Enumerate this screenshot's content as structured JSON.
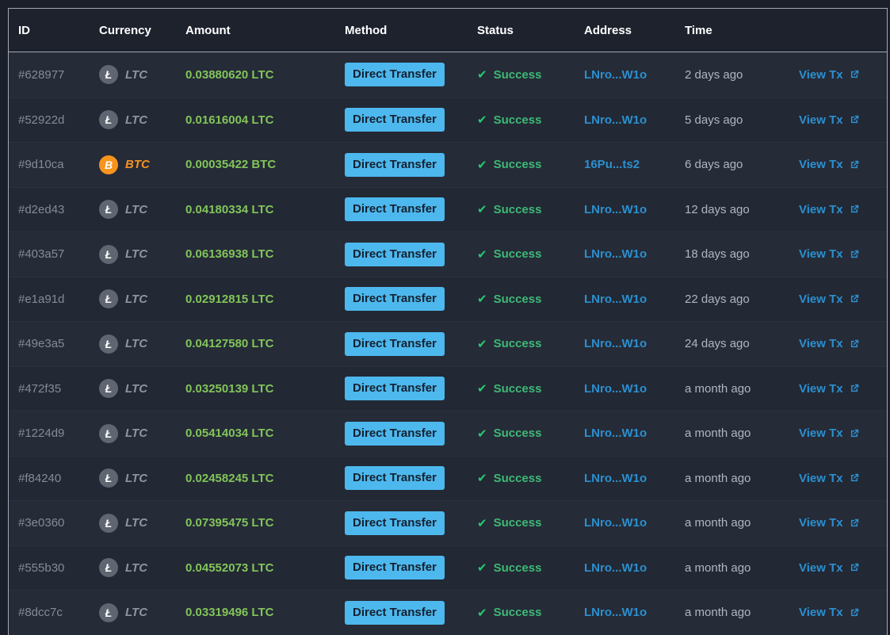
{
  "table": {
    "headers": {
      "id": "ID",
      "currency": "Currency",
      "amount": "Amount",
      "method": "Method",
      "status": "Status",
      "address": "Address",
      "time": "Time",
      "actions": ""
    },
    "rows": [
      {
        "id": "#628977",
        "currency": "LTC",
        "amount": "0.03880620 LTC",
        "method": "Direct Transfer",
        "status": "Success",
        "address": "LNro...W1o",
        "time": "2 days ago",
        "link": "View Tx"
      },
      {
        "id": "#52922d",
        "currency": "LTC",
        "amount": "0.01616004 LTC",
        "method": "Direct Transfer",
        "status": "Success",
        "address": "LNro...W1o",
        "time": "5 days ago",
        "link": "View Tx"
      },
      {
        "id": "#9d10ca",
        "currency": "BTC",
        "amount": "0.00035422 BTC",
        "method": "Direct Transfer",
        "status": "Success",
        "address": "16Pu...ts2",
        "time": "6 days ago",
        "link": "View Tx"
      },
      {
        "id": "#d2ed43",
        "currency": "LTC",
        "amount": "0.04180334 LTC",
        "method": "Direct Transfer",
        "status": "Success",
        "address": "LNro...W1o",
        "time": "12 days ago",
        "link": "View Tx"
      },
      {
        "id": "#403a57",
        "currency": "LTC",
        "amount": "0.06136938 LTC",
        "method": "Direct Transfer",
        "status": "Success",
        "address": "LNro...W1o",
        "time": "18 days ago",
        "link": "View Tx"
      },
      {
        "id": "#e1a91d",
        "currency": "LTC",
        "amount": "0.02912815 LTC",
        "method": "Direct Transfer",
        "status": "Success",
        "address": "LNro...W1o",
        "time": "22 days ago",
        "link": "View Tx"
      },
      {
        "id": "#49e3a5",
        "currency": "LTC",
        "amount": "0.04127580 LTC",
        "method": "Direct Transfer",
        "status": "Success",
        "address": "LNro...W1o",
        "time": "24 days ago",
        "link": "View Tx"
      },
      {
        "id": "#472f35",
        "currency": "LTC",
        "amount": "0.03250139 LTC",
        "method": "Direct Transfer",
        "status": "Success",
        "address": "LNro...W1o",
        "time": "a month ago",
        "link": "View Tx"
      },
      {
        "id": "#1224d9",
        "currency": "LTC",
        "amount": "0.05414034 LTC",
        "method": "Direct Transfer",
        "status": "Success",
        "address": "LNro...W1o",
        "time": "a month ago",
        "link": "View Tx"
      },
      {
        "id": "#f84240",
        "currency": "LTC",
        "amount": "0.02458245 LTC",
        "method": "Direct Transfer",
        "status": "Success",
        "address": "LNro...W1o",
        "time": "a month ago",
        "link": "View Tx"
      },
      {
        "id": "#3e0360",
        "currency": "LTC",
        "amount": "0.07395475 LTC",
        "method": "Direct Transfer",
        "status": "Success",
        "address": "LNro...W1o",
        "time": "a month ago",
        "link": "View Tx"
      },
      {
        "id": "#555b30",
        "currency": "LTC",
        "amount": "0.04552073 LTC",
        "method": "Direct Transfer",
        "status": "Success",
        "address": "LNro...W1o",
        "time": "a month ago",
        "link": "View Tx"
      },
      {
        "id": "#8dcc7c",
        "currency": "LTC",
        "amount": "0.03319496 LTC",
        "method": "Direct Transfer",
        "status": "Success",
        "address": "LNro...W1o",
        "time": "a month ago",
        "link": "View Tx"
      }
    ]
  },
  "icons": {
    "coin_symbols": {
      "LTC": "Ł",
      "BTC": "B"
    },
    "success_check": "✔"
  },
  "colors": {
    "amount_green": "#82c45a",
    "status_green": "#3eb976",
    "link_blue": "#2b90d0",
    "badge_blue": "#4db8ee",
    "btc_orange": "#f7941d",
    "ltc_gray": "#5f6671"
  }
}
